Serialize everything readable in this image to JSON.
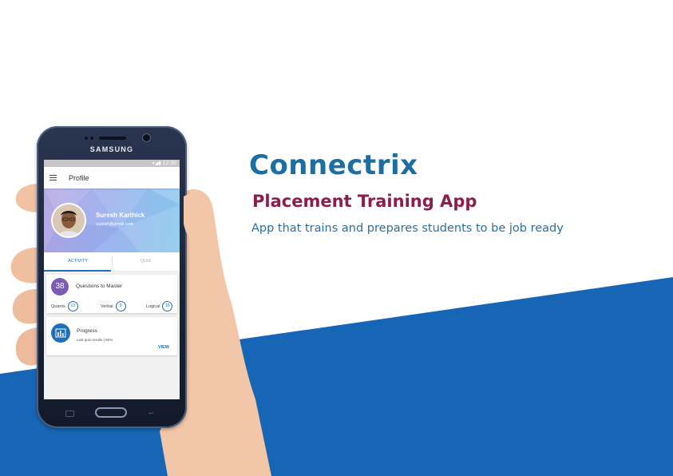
{
  "colors": {
    "background": "#ffffff",
    "accent_blue": "#1666b5",
    "title_blue": "#1d6ea3",
    "subtitle_crimson": "#8c1e4c",
    "tagline_blue": "#2b6fa0",
    "badge_purple": "#7c5bb5"
  },
  "hero": {
    "title": "Connectrix",
    "subtitle": "Placement Training App",
    "tagline": "App that trains and prepares students to be job ready"
  },
  "phone": {
    "brand": "SAMSUNG",
    "status_time": "12:30",
    "toolbar": {
      "menu_icon": "hamburger-menu-icon",
      "title": "Profile"
    },
    "profile": {
      "name": "Suresh Karthick",
      "email": "suresh@gmail.com"
    },
    "tabs": [
      {
        "label": "ACTIVITY",
        "active": true
      },
      {
        "label": "QUIZ",
        "active": false
      }
    ],
    "questions_card": {
      "count": "38",
      "title": "Questions to Master",
      "stats": [
        {
          "label": "Quants",
          "value": "13"
        },
        {
          "label": "Verbal",
          "value": "9"
        },
        {
          "label": "Logical",
          "value": "16"
        }
      ]
    },
    "progress_card": {
      "icon": "bar-chart-icon",
      "title": "Progress",
      "subtitle": "Last quiz results | 65%",
      "action": "VIEW"
    }
  }
}
